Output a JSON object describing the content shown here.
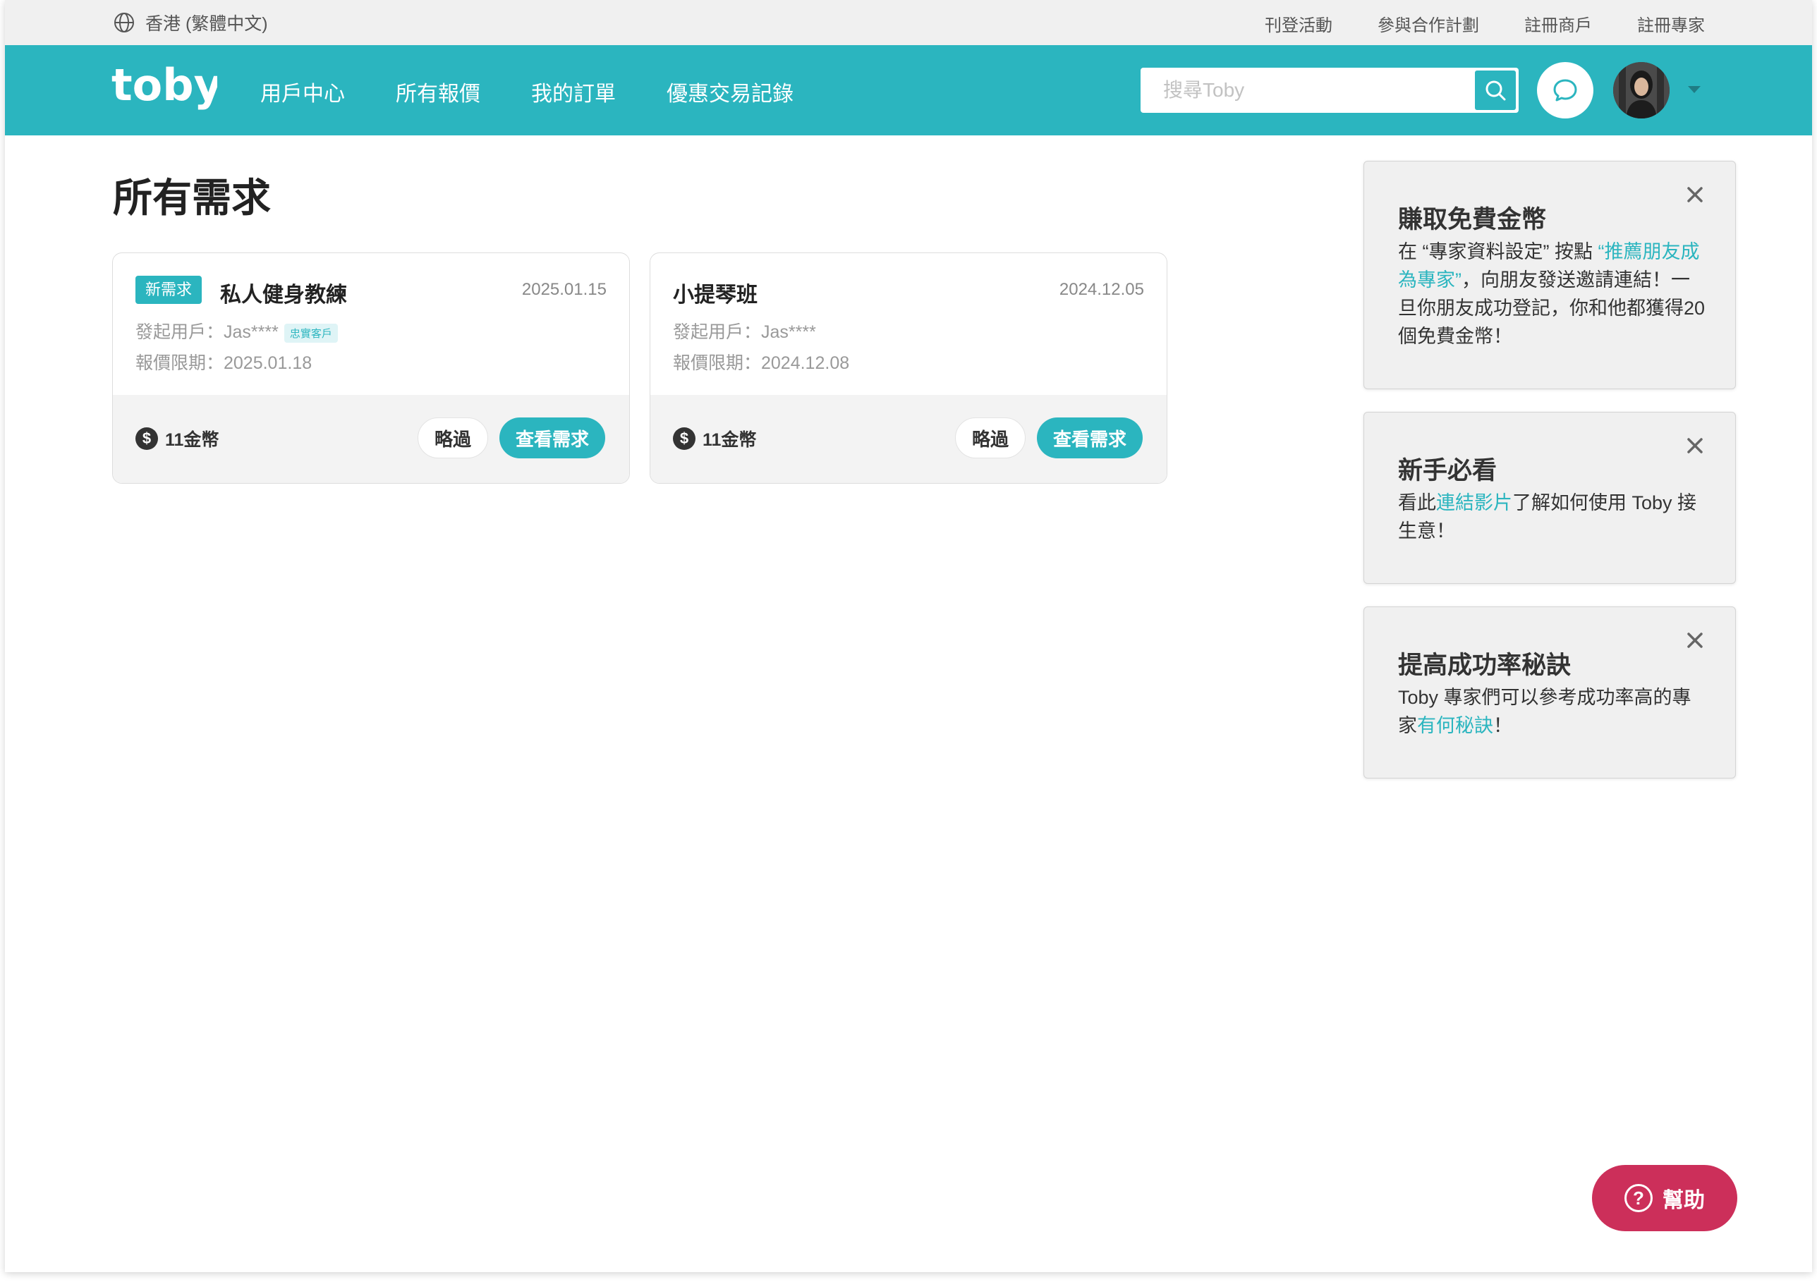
{
  "topbar": {
    "locale": "香港 (繁體中文)",
    "links": [
      "刊登活動",
      "參與合作計劃",
      "註冊商戶",
      "註冊專家"
    ]
  },
  "navbar": {
    "logo": "toby",
    "links": [
      "用戶中心",
      "所有報價",
      "我的訂單",
      "優惠交易記錄"
    ],
    "search_placeholder": "搜尋Toby",
    "brand_color": "#2bb5bf"
  },
  "page_title": "所有需求",
  "requests": [
    {
      "badge": "新需求",
      "title": "私人健身教練",
      "date": "2025.01.15",
      "requester": "發起用戶：Jas****",
      "loyal_tag": "忠實客戶",
      "deadline": "報價限期：2025.01.18",
      "coins": "11金幣",
      "skip_label": "略過",
      "view_label": "查看需求"
    },
    {
      "badge": "",
      "title": "小提琴班",
      "date": "2024.12.05",
      "requester": "發起用戶：Jas****",
      "loyal_tag": "",
      "deadline": "報價限期：2024.12.08",
      "coins": "11金幣",
      "skip_label": "略過",
      "view_label": "查看需求"
    }
  ],
  "tips": [
    {
      "title": "賺取免費金幣",
      "parts": [
        "在 “專家資料設定” 按點 ",
        "“推薦朋友成為專家”",
        "，向朋友發送邀請連結！一旦你朋友成功登記，你和他都獲得20個免費金幣！"
      ]
    },
    {
      "title": "新手必看",
      "parts": [
        "看此",
        "連結影片",
        "了解如何使用 Toby 接生意！"
      ]
    },
    {
      "title": "提高成功率秘訣",
      "parts": [
        "Toby 專家們可以參考成功率高的專家",
        "有何秘訣",
        "！"
      ]
    }
  ],
  "help_label": "幫助",
  "help_color": "#cc2f5a"
}
